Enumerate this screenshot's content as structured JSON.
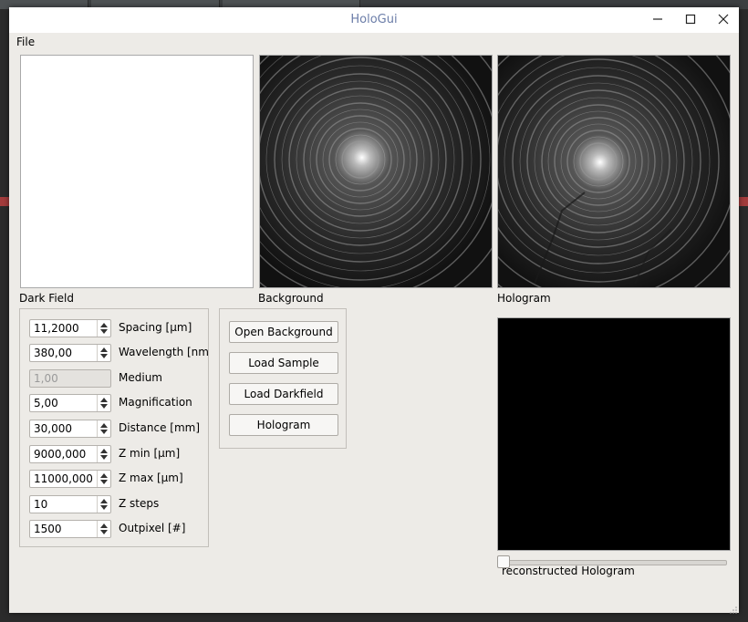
{
  "window": {
    "title": "HoloGui"
  },
  "menu": {
    "file": "File"
  },
  "panels": {
    "dark_field_label": "Dark Field",
    "background_label": "Background",
    "hologram_label": "Hologram",
    "reconstructed_label": "reconstructed Hologram"
  },
  "parameters": [
    {
      "value": "11,2000",
      "label": "Spacing [µm]",
      "enabled": true
    },
    {
      "value": "380,00",
      "label": "Wavelength [nm",
      "enabled": true
    },
    {
      "value": "1,00",
      "label": "Medium",
      "enabled": false
    },
    {
      "value": "5,00",
      "label": "Magnification",
      "enabled": true
    },
    {
      "value": "30,000",
      "label": "Distance [mm]",
      "enabled": true
    },
    {
      "value": "9000,000",
      "label": "Z min [µm]",
      "enabled": true
    },
    {
      "value": "11000,000",
      "label": "Z max [µm]",
      "enabled": true
    },
    {
      "value": "10",
      "label": "Z steps",
      "enabled": true
    },
    {
      "value": "1500",
      "label": "Outpixel [#]",
      "enabled": true
    }
  ],
  "buttons": {
    "open_background": "Open Background",
    "load_sample": "Load Sample",
    "load_darkfield": "Load Darkfield",
    "hologram": "Hologram"
  },
  "slider": {
    "value_fraction": 0.0
  },
  "icons": {
    "minimize": "minimize-icon",
    "maximize": "maximize-icon",
    "close": "close-icon"
  },
  "colors": {
    "window_bg": "#edebe7",
    "title_text": "#6b7da8"
  }
}
